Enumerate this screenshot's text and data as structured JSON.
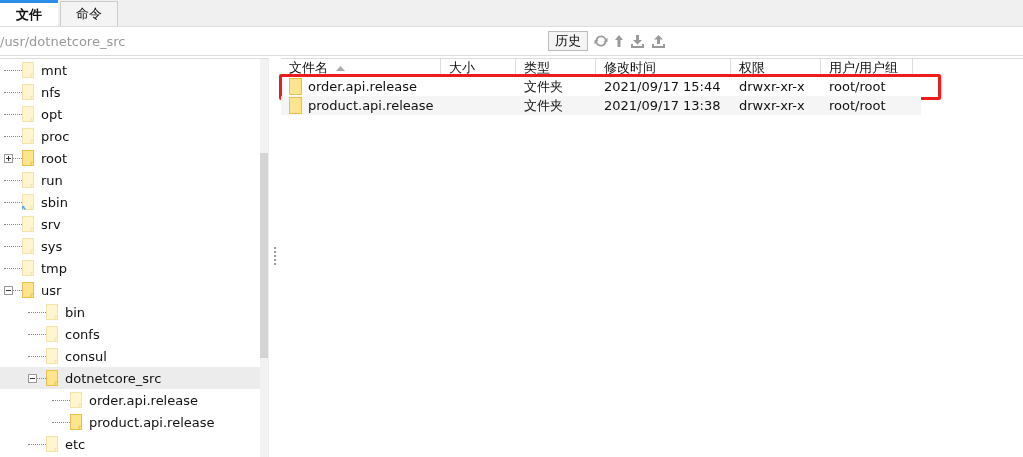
{
  "tabs": [
    {
      "label": "文件",
      "selected": true
    },
    {
      "label": "命令",
      "selected": false
    }
  ],
  "path_bar": {
    "value": "/usr/dotnetcore_src",
    "history_button": "历史"
  },
  "tree": {
    "items": [
      {
        "name": "mnt",
        "loaded": false,
        "selected": false
      },
      {
        "name": "nfs",
        "loaded": false,
        "selected": false
      },
      {
        "name": "opt",
        "loaded": false,
        "selected": false
      },
      {
        "name": "proc",
        "loaded": false,
        "selected": false
      },
      {
        "name": "root",
        "loaded": true,
        "selected": false,
        "expanded": false
      },
      {
        "name": "run",
        "loaded": false,
        "selected": false
      },
      {
        "name": "sbin",
        "loaded": false,
        "selected": false,
        "link": true
      },
      {
        "name": "srv",
        "loaded": false,
        "selected": false
      },
      {
        "name": "sys",
        "loaded": false,
        "selected": false
      },
      {
        "name": "tmp",
        "loaded": false,
        "selected": false
      },
      {
        "name": "usr",
        "loaded": true,
        "selected": false,
        "expanded": true,
        "children": [
          {
            "name": "bin",
            "loaded": false,
            "selected": false
          },
          {
            "name": "confs",
            "loaded": false,
            "selected": false
          },
          {
            "name": "consul",
            "loaded": false,
            "selected": false
          },
          {
            "name": "dotnetcore_src",
            "loaded": true,
            "selected": true,
            "expanded": true,
            "children": [
              {
                "name": "order.api.release",
                "loaded": false,
                "selected": false
              },
              {
                "name": "product.api.release",
                "loaded": true,
                "selected": false
              }
            ]
          },
          {
            "name": "etc",
            "loaded": false,
            "selected": false
          }
        ]
      }
    ]
  },
  "file_list": {
    "columns": [
      {
        "label": "文件名",
        "sorted_ascending": true
      },
      {
        "label": "大小"
      },
      {
        "label": "类型"
      },
      {
        "label": "修改时间"
      },
      {
        "label": "权限"
      },
      {
        "label": "用户/用户组"
      }
    ],
    "rows": [
      {
        "cells": [
          "order.api.release",
          "",
          "文件夹",
          "2021/09/17 15:44",
          "drwxr-xr-x",
          "root/root"
        ],
        "highlighted": true
      },
      {
        "cells": [
          "product.api.release",
          "",
          "文件夹",
          "2021/09/17 13:38",
          "drwxr-xr-x",
          "root/root"
        ],
        "highlighted": false
      }
    ]
  }
}
